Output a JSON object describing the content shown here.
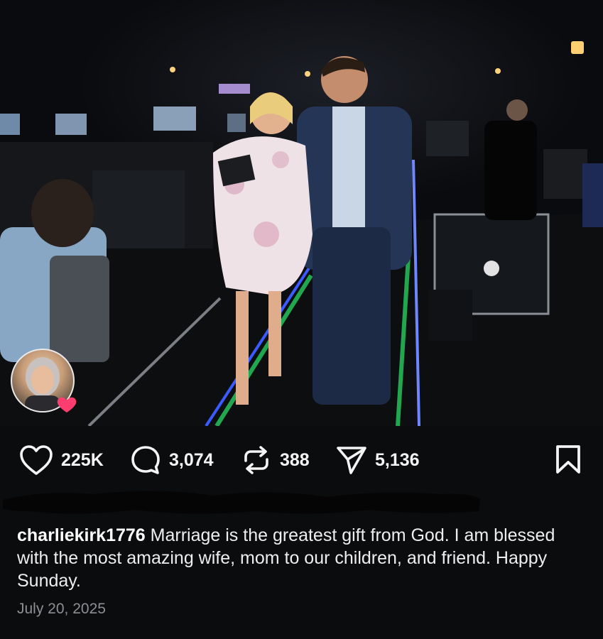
{
  "post": {
    "image_alt": "Couple walking backstage",
    "stats": {
      "likes": "225K",
      "comments": "3,074",
      "reposts": "388",
      "shares": "5,136"
    },
    "caption": {
      "username": "charliekirk1776",
      "text": "Marriage is the greatest gift from God. I am blessed with the most amazing wife, mom to our children, and friend. Happy Sunday."
    },
    "date": "July 20, 2025"
  },
  "icons": {
    "like": "heart-icon",
    "comment": "comment-bubble-icon",
    "repost": "repost-arrows-icon",
    "share": "paper-plane-icon",
    "save": "bookmark-icon",
    "reaction_badge": "heart-icon"
  },
  "colors": {
    "background": "#0b0c0e",
    "text": "#f2f2f2",
    "date": "#8d8f93",
    "heart_badge": "#ff3d6e",
    "neon_blue": "#3a5bff",
    "neon_green": "#24c25a"
  }
}
